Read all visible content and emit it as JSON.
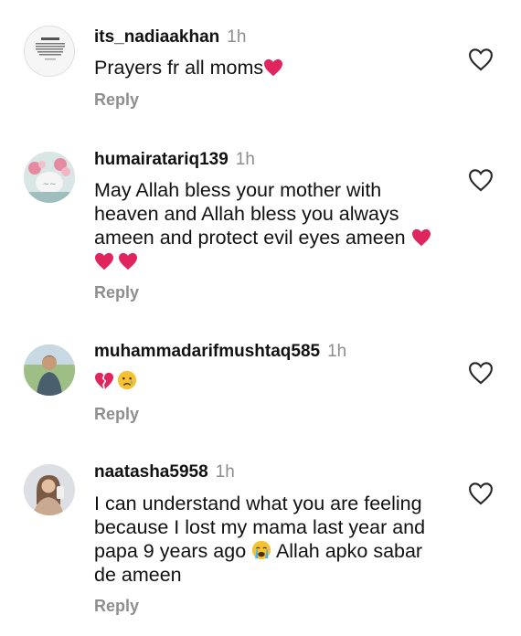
{
  "comments": [
    {
      "username": "its_nadiaakhan",
      "time": "1h",
      "text": "Prayers fr all moms",
      "emoji_after_text": [
        "red-heart"
      ],
      "reply_label": "Reply",
      "avatar": "quote-image-avatar",
      "liked": false
    },
    {
      "username": "humairatariq139",
      "time": "1h",
      "text_lines": [
        "May Allah bless your mother with",
        "heaven and Allah bless you always",
        "ameen and protect evil eyes ameen"
      ],
      "emoji_after_text": [
        "red-heart",
        "red-heart",
        "red-heart"
      ],
      "reply_label": "Reply",
      "avatar": "flowers-avatar",
      "liked": false
    },
    {
      "username": "muhammadarifmushtaq585",
      "time": "1h",
      "text": "",
      "emoji_only": [
        "broken-heart",
        "crying-face"
      ],
      "reply_label": "Reply",
      "avatar": "man-photo-avatar",
      "liked": false
    },
    {
      "username": "naatasha5958",
      "time": "1h",
      "text_lines": [
        "I can understand what you are feeling",
        "because I lost my mama last year and",
        "papa 9 years ago",
        "Allah apko sabar",
        "de ameen"
      ],
      "emoji_inline": [
        "loudly-crying-face"
      ],
      "reply_label": "Reply",
      "avatar": "woman-photo-avatar",
      "liked": false
    }
  ],
  "colors": {
    "text": "#111111",
    "muted": "#8e8e8e",
    "heart_emoji": "#e0245e",
    "like_outline": "#262626"
  }
}
